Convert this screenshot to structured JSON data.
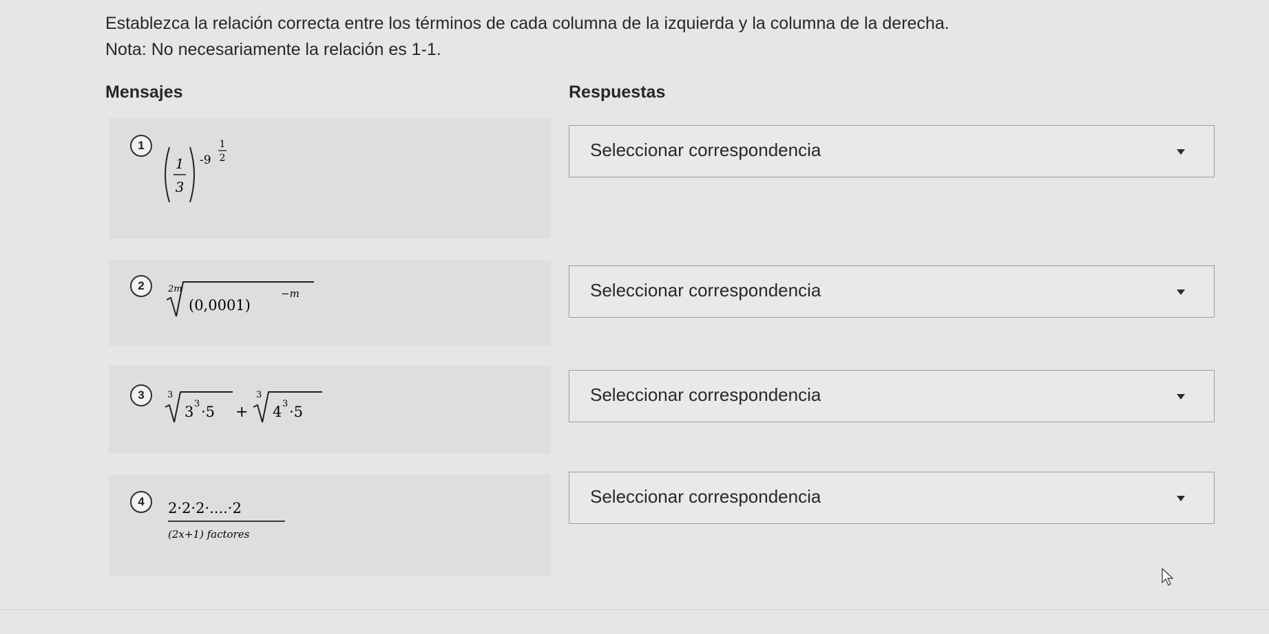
{
  "instructions": {
    "line1": "Establezca la relación correcta entre los términos de cada columna de la izquierda y la columna de la derecha.",
    "line2": "Nota: No necesariamente la relación es 1-1."
  },
  "columns": {
    "left": "Mensajes",
    "right": "Respuestas"
  },
  "questions": [
    {
      "number": "1",
      "expr": {
        "frac_num": "1",
        "frac_den": "3",
        "outer_exp": "-9",
        "exp_num": "1",
        "exp_den": "2"
      }
    },
    {
      "number": "2",
      "expr": {
        "index": "2m",
        "radicand": "(0,0001)",
        "radicand_exp": "−m"
      }
    },
    {
      "number": "3",
      "expr": {
        "i1": "3",
        "b1": "3",
        "e1": "3",
        "m1": "·5",
        "plus": "+",
        "i2": "3",
        "b2": "4",
        "e2": "3",
        "m2": "·5"
      }
    },
    {
      "number": "4",
      "expr": {
        "top": "2·2·2·....·2",
        "bottom": "(2x+1) factores"
      }
    }
  ],
  "answers": [
    {
      "label": "Seleccionar correspondencia"
    },
    {
      "label": "Seleccionar correspondencia"
    },
    {
      "label": "Seleccionar correspondencia"
    },
    {
      "label": "Seleccionar correspondencia"
    }
  ]
}
